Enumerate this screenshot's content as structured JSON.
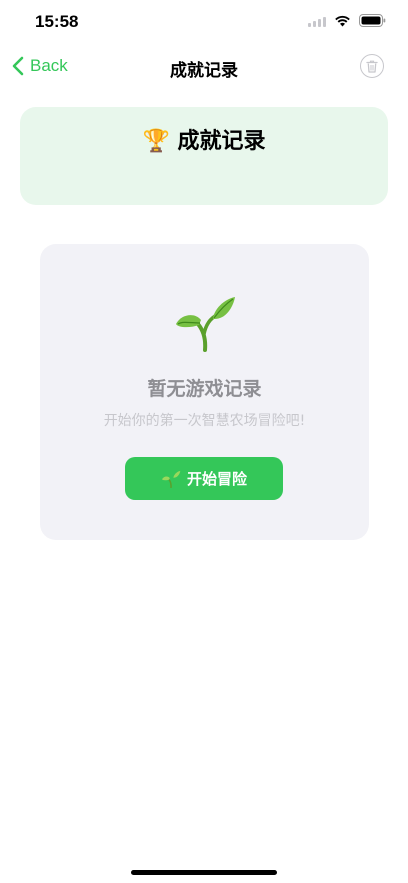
{
  "status_bar": {
    "time": "15:58"
  },
  "nav": {
    "back_label": "Back",
    "title": "成就记录",
    "trash_icon": "trash-icon"
  },
  "header": {
    "emoji": "🏆",
    "title": "成就记录"
  },
  "empty_state": {
    "icon": "sprout-icon",
    "title": "暂无游戏记录",
    "subtitle": "开始你的第一次智慧农场冒险吧!",
    "button_label": "开始冒险"
  },
  "colors": {
    "accent": "#34c759",
    "header_bg": "#e8f7ec",
    "card_bg": "#f2f2f7",
    "muted_text": "#8e8e93",
    "light_text": "#c7c7cc"
  }
}
